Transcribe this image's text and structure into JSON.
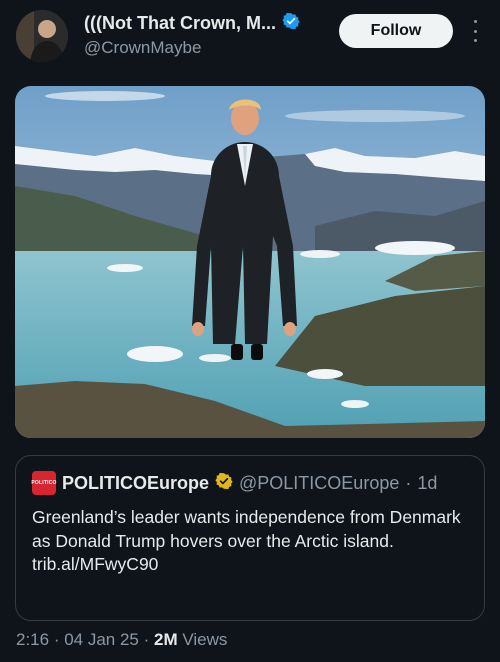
{
  "post": {
    "author_name": "(((Not That Crown, M...",
    "author_handle": "@CrownMaybe",
    "verified_badge": "verified-badge-icon",
    "follow_label": "Follow",
    "more_icon": "more-vertical-icon",
    "media": {
      "description_icon": "image"
    }
  },
  "quote": {
    "source_logo_text": "POLITICO",
    "name": "POLITICOEurope",
    "badge": "gold-verified-badge-icon",
    "handle": "@POLITICOEurope",
    "separator": "·",
    "age": "1d",
    "text": "Greenland’s leader wants independence from Denmark as Donald Trump hovers over the Arctic island.",
    "link": "trib.al/MFwyC90"
  },
  "meta": {
    "time": "2:16",
    "sep1": " · ",
    "date": "04 Jan 25",
    "sep2": " · ",
    "views_count": "2M",
    "views_label": " Views"
  },
  "colors": {
    "background": "#0f141a",
    "verified_blue": "#1d9bf0",
    "gold_badge": "#e2b719",
    "politico_red": "#d7262f"
  }
}
